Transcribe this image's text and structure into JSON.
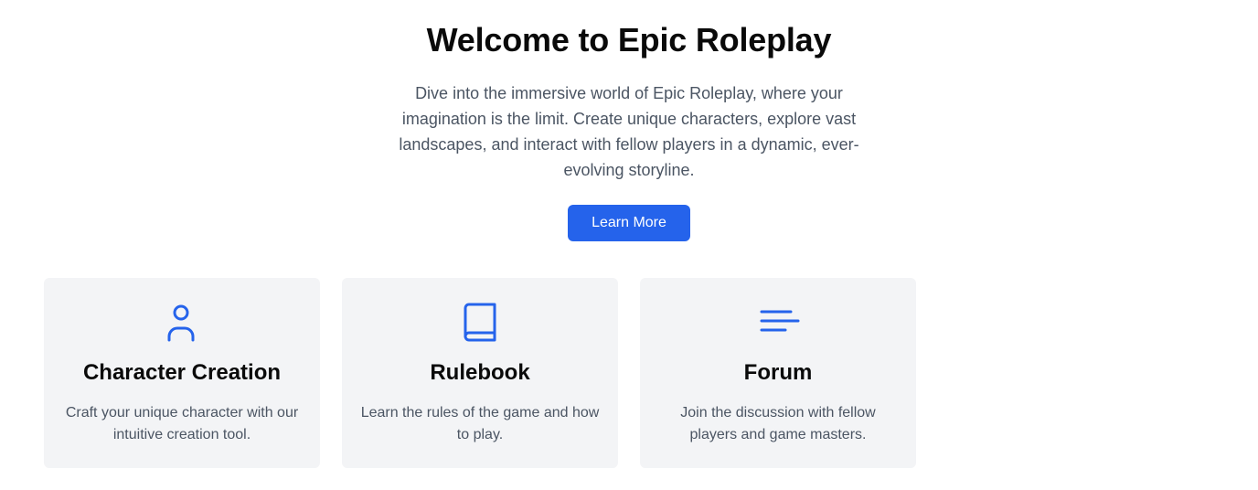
{
  "hero": {
    "title": "Welcome to Epic Roleplay",
    "description": "Dive into the immersive world of Epic Roleplay, where your imagination is the limit. Create unique characters, explore vast landscapes, and interact with fellow players in a dynamic, ever-evolving storyline.",
    "cta_label": "Learn More"
  },
  "features": [
    {
      "icon": "user-icon",
      "title": "Character Creation",
      "description": "Craft your unique character with our intuitive creation tool."
    },
    {
      "icon": "book-icon",
      "title": "Rulebook",
      "description": "Learn the rules of the game and how to play."
    },
    {
      "icon": "menu-lines-icon",
      "title": "Forum",
      "description": "Join the discussion with fellow players and game masters."
    }
  ],
  "colors": {
    "accent": "#2563eb",
    "card_background": "#f3f4f6",
    "body_text": "#4b5563",
    "heading_text": "#0a0a0a"
  }
}
